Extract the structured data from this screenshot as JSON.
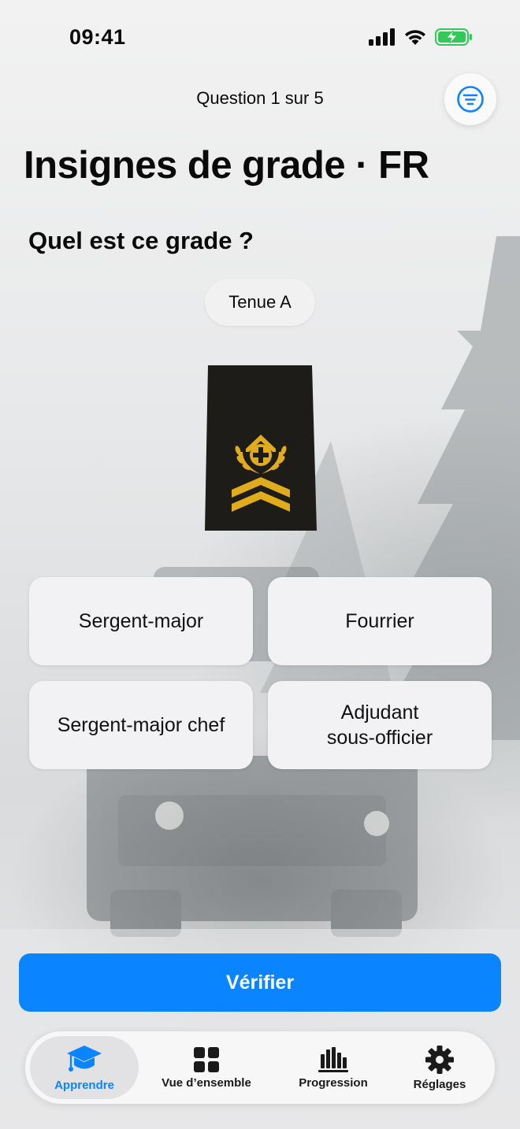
{
  "status_bar": {
    "time": "09:41"
  },
  "header": {
    "question_counter": "Question 1 sur 5",
    "filter_icon": "filter-lines-icon"
  },
  "page": {
    "title": "Insignes de grade · FR",
    "question": "Quel est ce grade ?"
  },
  "uniform": {
    "label": "Tenue A"
  },
  "answers": [
    {
      "label": "Sergent-major"
    },
    {
      "label": "Fourrier"
    },
    {
      "label": "Sergent-major chef"
    },
    {
      "label": "Adjudant\nsous-officier"
    }
  ],
  "verify_button": {
    "label": "Vérifier"
  },
  "tabbar": {
    "items": [
      {
        "label": "Apprendre",
        "icon": "graduation-cap-icon",
        "active": true
      },
      {
        "label": "Vue d’ensemble",
        "icon": "grid-icon",
        "active": false
      },
      {
        "label": "Progression",
        "icon": "bar-chart-icon",
        "active": false
      },
      {
        "label": "Réglages",
        "icon": "gear-icon",
        "active": false
      }
    ]
  },
  "colors": {
    "accent": "#0a84ff",
    "insignia_gold": "#e0ac1c",
    "insignia_black": "#1d1c18",
    "battery": "#34c759"
  }
}
